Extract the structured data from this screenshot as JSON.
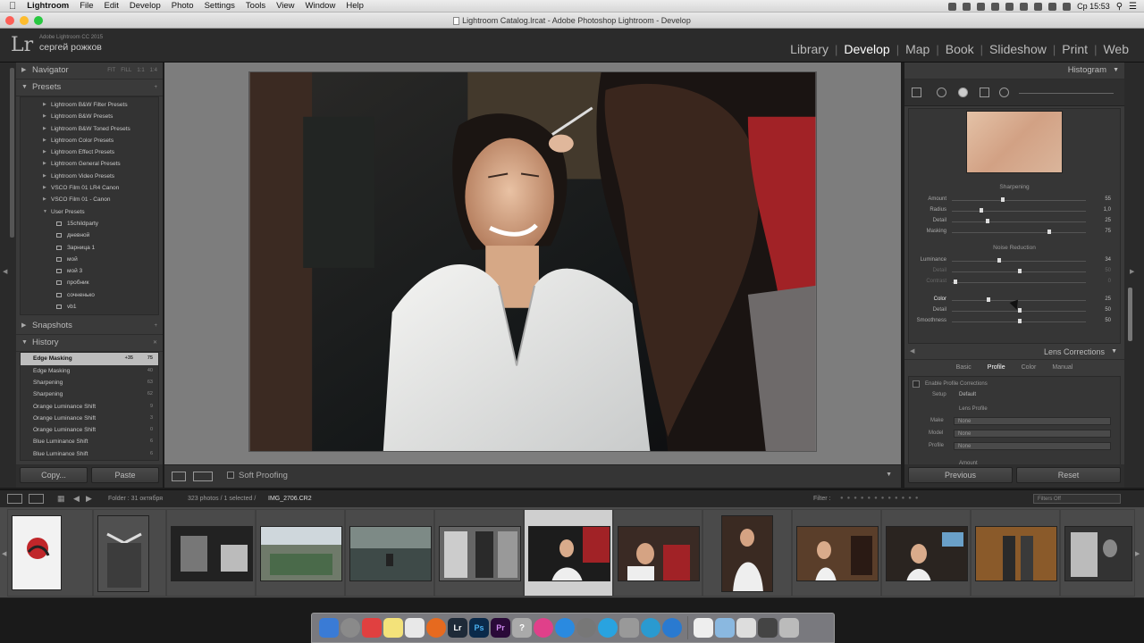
{
  "menubar": {
    "app": "Lightroom",
    "items": [
      "File",
      "Edit",
      "Develop",
      "Photo",
      "Settings",
      "Tools",
      "View",
      "Window",
      "Help"
    ],
    "clock": "Ср 15:53"
  },
  "window": {
    "title": "Lightroom Catalog.lrcat - Adobe Photoshop Lightroom - Develop"
  },
  "identity": {
    "product": "Adobe Lightroom CC 2015",
    "user": "сергей рожков"
  },
  "modules": [
    "Library",
    "Develop",
    "Map",
    "Book",
    "Slideshow",
    "Print",
    "Web"
  ],
  "left": {
    "navigator": "Navigator",
    "nav_zoom": [
      "FIT",
      "FILL",
      "1:1",
      "1:4"
    ],
    "presets": "Presets",
    "preset_items": [
      "Lightroom B&W Filter Presets",
      "Lightroom B&W Presets",
      "Lightroom B&W Toned Presets",
      "Lightroom Color Presets",
      "Lightroom Effect Presets",
      "Lightroom General Presets",
      "Lightroom Video Presets",
      "VSCO Film 01 LR4 Canon",
      "VSCO Film 01 - Canon",
      "User Presets"
    ],
    "user_presets": [
      "15сhildparty",
      "дневной",
      "Зарница 1",
      "мой",
      "мой 3",
      "пробник",
      "сочненько",
      "vb1"
    ],
    "snapshots": "Snapshots",
    "history": "History",
    "history_items": [
      {
        "name": "Edge Masking",
        "v1": "+35",
        "v2": "75"
      },
      {
        "name": "Edge Masking",
        "v1": "",
        "v2": "40"
      },
      {
        "name": "Sharpening",
        "v1": "",
        "v2": "63"
      },
      {
        "name": "Sharpening",
        "v1": "",
        "v2": "62"
      },
      {
        "name": "Orange Luminance Shift",
        "v1": "",
        "v2": "9"
      },
      {
        "name": "Orange Luminance Shift",
        "v1": "",
        "v2": "3"
      },
      {
        "name": "Orange Luminance Shift",
        "v1": "",
        "v2": "0"
      },
      {
        "name": "Blue Luminance Shift",
        "v1": "",
        "v2": "6"
      },
      {
        "name": "Blue Luminance Shift",
        "v1": "",
        "v2": "6"
      }
    ],
    "copy": "Copy...",
    "paste": "Paste"
  },
  "toolbar": {
    "soft_proofing": "Soft Proofing"
  },
  "right": {
    "histogram": "Histogram",
    "sharpening": "Sharpening",
    "sharp_sliders": [
      {
        "label": "Amount",
        "value": "55"
      },
      {
        "label": "Radius",
        "value": "1,0"
      },
      {
        "label": "Detail",
        "value": "25"
      },
      {
        "label": "Masking",
        "value": "75"
      }
    ],
    "noise_reduction": "Noise Reduction",
    "noise_sliders": [
      {
        "label": "Luminance",
        "value": "34"
      },
      {
        "label": "Detail",
        "value": "50"
      },
      {
        "label": "Contrast",
        "value": "0"
      }
    ],
    "color_sliders": [
      {
        "label": "Color",
        "value": "25"
      },
      {
        "label": "Detail",
        "value": "50"
      },
      {
        "label": "Smoothness",
        "value": "50"
      }
    ],
    "lens": "Lens Corrections",
    "lens_tabs": [
      "Basic",
      "Profile",
      "Color",
      "Manual"
    ],
    "enable_profile": "Enable Profile Corrections",
    "setup_label": "Setup",
    "setup_value": "Default",
    "lens_profile": "Lens Profile",
    "make": "Make",
    "model": "Model",
    "profile": "Profile",
    "make_value": "None",
    "model_value": "None",
    "profile_value": "None",
    "amount": "Amount",
    "previous": "Previous",
    "reset": "Reset"
  },
  "filmstrip": {
    "folder": "Folder : 31 октября",
    "count": "323 photos / 1 selected /",
    "filename": "IMG_2706.CR2",
    "filter": "Filter :",
    "filters_off": "Filters Off"
  }
}
